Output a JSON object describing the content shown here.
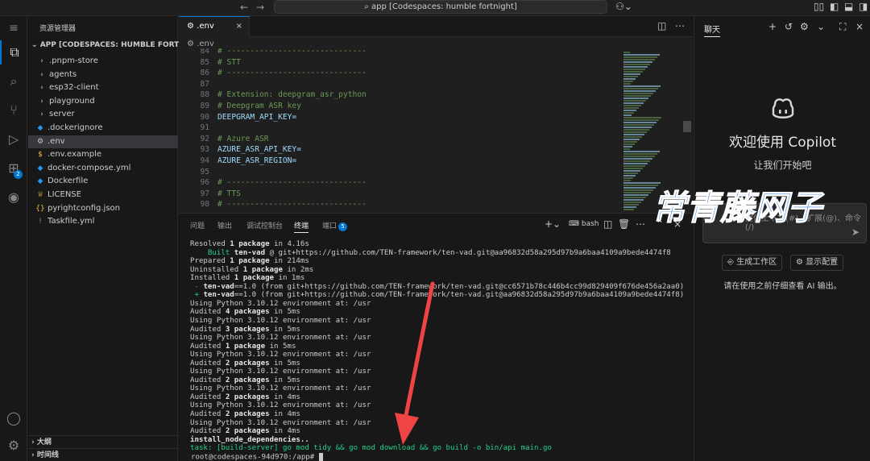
{
  "titlebar": {
    "search_text": "app [Codespaces: humble fortnight]"
  },
  "activity_bar": {
    "run_badge": "2"
  },
  "explorer": {
    "title": "资源管理器",
    "root_label": "APP [CODESPACES: HUMBLE FORTNIG...",
    "items": [
      {
        "label": ".pnpm-store",
        "kind": "folder",
        "icon": "chevron-right-icon"
      },
      {
        "label": "agents",
        "kind": "folder",
        "icon": "chevron-right-icon"
      },
      {
        "label": "esp32-client",
        "kind": "folder",
        "icon": "chevron-right-icon"
      },
      {
        "label": "playground",
        "kind": "folder",
        "icon": "chevron-right-icon"
      },
      {
        "label": "server",
        "kind": "folder",
        "icon": "chevron-right-icon"
      },
      {
        "label": ".dockerignore",
        "kind": "file",
        "icon": "docker-icon"
      },
      {
        "label": ".env",
        "kind": "file",
        "icon": "gear-icon"
      },
      {
        "label": ".env.example",
        "kind": "file",
        "icon": "dollar-icon"
      },
      {
        "label": "docker-compose.yml",
        "kind": "file",
        "icon": "docker-icon"
      },
      {
        "label": "Dockerfile",
        "kind": "file",
        "icon": "docker-icon"
      },
      {
        "label": "LICENSE",
        "kind": "file",
        "icon": "license-icon"
      },
      {
        "label": "pyrightconfig.json",
        "kind": "file",
        "icon": "json-braces-icon"
      },
      {
        "label": "Taskfile.yml",
        "kind": "file",
        "icon": "yaml-icon"
      }
    ],
    "outline_label": "大纲",
    "timeline_label": "时间线"
  },
  "editor": {
    "tab_label": ".env",
    "breadcrumb": ".env",
    "lines": [
      {
        "n": "84",
        "text": "# ------------------------------",
        "kind": "comment"
      },
      {
        "n": "85",
        "text": "# STT",
        "kind": "comment"
      },
      {
        "n": "86",
        "text": "# ------------------------------",
        "kind": "comment"
      },
      {
        "n": "87",
        "text": "",
        "kind": "plain"
      },
      {
        "n": "88",
        "text": "# Extension: deepgram_asr_python",
        "kind": "comment"
      },
      {
        "n": "89",
        "text": "# Deepgram ASR key",
        "kind": "comment"
      },
      {
        "n": "90",
        "text": "DEEPGRAM_API_KEY=",
        "kind": "key"
      },
      {
        "n": "91",
        "text": "",
        "kind": "plain"
      },
      {
        "n": "92",
        "text": "# Azure ASR",
        "kind": "comment"
      },
      {
        "n": "93",
        "text": "AZURE_ASR_API_KEY=",
        "kind": "key"
      },
      {
        "n": "94",
        "text": "AZURE_ASR_REGION=",
        "kind": "key"
      },
      {
        "n": "95",
        "text": "",
        "kind": "plain"
      },
      {
        "n": "96",
        "text": "# ------------------------------",
        "kind": "comment"
      },
      {
        "n": "97",
        "text": "# TTS",
        "kind": "comment"
      },
      {
        "n": "98",
        "text": "# ------------------------------",
        "kind": "comment"
      }
    ]
  },
  "panel": {
    "tabs": [
      "问题",
      "输出",
      "调试控制台",
      "终端",
      "端口"
    ],
    "active_tab": "终端",
    "ports_badge": "5",
    "shell_label": "bash",
    "terminal_lines": [
      [
        {
          "t": "Resolved "
        },
        {
          "t": "1 package",
          "s": "b"
        },
        {
          "t": " in 4.16s"
        }
      ],
      [
        {
          "t": "    "
        },
        {
          "t": "Built",
          "s": "green"
        },
        {
          "t": " "
        },
        {
          "t": "ten-vad",
          "s": "b"
        },
        {
          "t": " @ git+https://github.com/TEN-framework/ten-vad.git@aa96832d58a295d97b9a6baa4109a9bede4474f8"
        }
      ],
      [
        {
          "t": "Prepared "
        },
        {
          "t": "1 package",
          "s": "b"
        },
        {
          "t": " in 214ms"
        }
      ],
      [
        {
          "t": "Uninstalled "
        },
        {
          "t": "1 package",
          "s": "b"
        },
        {
          "t": " in 2ms"
        }
      ],
      [
        {
          "t": "Installed "
        },
        {
          "t": "1 package",
          "s": "b"
        },
        {
          "t": " in 1ms"
        }
      ],
      [
        {
          "t": " - ",
          "s": "red"
        },
        {
          "t": "ten-vad",
          "s": "b"
        },
        {
          "t": "==1.0 (from git+https://github.com/TEN-framework/ten-vad.git@cc6571b78c446b4cc99d829409f676de456a2aa0)"
        }
      ],
      [
        {
          "t": " + ",
          "s": "green"
        },
        {
          "t": "ten-vad",
          "s": "b"
        },
        {
          "t": "==1.0 (from git+https://github.com/TEN-framework/ten-vad.git@aa96832d58a295d97b9a6baa4109a9bede4474f8)"
        }
      ],
      [
        {
          "t": "Using Python 3.10.12 environment at: /usr"
        }
      ],
      [
        {
          "t": "Audited "
        },
        {
          "t": "4 packages",
          "s": "b"
        },
        {
          "t": " in 5ms"
        }
      ],
      [
        {
          "t": "Using Python 3.10.12 environment at: /usr"
        }
      ],
      [
        {
          "t": "Audited "
        },
        {
          "t": "3 packages",
          "s": "b"
        },
        {
          "t": " in 5ms"
        }
      ],
      [
        {
          "t": "Using Python 3.10.12 environment at: /usr"
        }
      ],
      [
        {
          "t": "Audited "
        },
        {
          "t": "1 package",
          "s": "b"
        },
        {
          "t": " in 5ms"
        }
      ],
      [
        {
          "t": "Using Python 3.10.12 environment at: /usr"
        }
      ],
      [
        {
          "t": "Audited "
        },
        {
          "t": "2 packages",
          "s": "b"
        },
        {
          "t": " in 5ms"
        }
      ],
      [
        {
          "t": "Using Python 3.10.12 environment at: /usr"
        }
      ],
      [
        {
          "t": "Audited "
        },
        {
          "t": "2 packages",
          "s": "b"
        },
        {
          "t": " in 5ms"
        }
      ],
      [
        {
          "t": "Using Python 3.10.12 environment at: /usr"
        }
      ],
      [
        {
          "t": "Audited "
        },
        {
          "t": "2 packages",
          "s": "b"
        },
        {
          "t": " in 4ms"
        }
      ],
      [
        {
          "t": "Using Python 3.10.12 environment at: /usr"
        }
      ],
      [
        {
          "t": "Audited "
        },
        {
          "t": "2 packages",
          "s": "b"
        },
        {
          "t": " in 4ms"
        }
      ],
      [
        {
          "t": "Using Python 3.10.12 environment at: /usr"
        }
      ],
      [
        {
          "t": "Audited "
        },
        {
          "t": "2 packages",
          "s": "b"
        },
        {
          "t": " in 4ms"
        }
      ],
      [
        {
          "t": "install_node_dependencies..",
          "s": "b"
        }
      ],
      [
        {
          "t": "task: [build-server] go mod tidy && go mod download && go build -o bin/api main.go",
          "s": "green"
        }
      ]
    ],
    "prompt": "root@codespaces-94d970:/app# "
  },
  "chat": {
    "title": "聊天",
    "welcome_title": "欢迎使用 Copilot",
    "welcome_sub": "让我们开始吧",
    "input_placeholder": "提供上下文(#)、扩展(@)、命令(/)",
    "button_workspace": "生成工作区",
    "button_config": "显示配置",
    "note": "请在使用之前仔细查看 AI 输出。"
  },
  "watermark": {
    "text": "常青藤网子"
  },
  "colors": {
    "accent": "#0078d4",
    "comment": "#6a9955",
    "env_key": "#9cdcfe",
    "annotation_arrow": "#ef4444",
    "watermark": "#2f7de0"
  }
}
